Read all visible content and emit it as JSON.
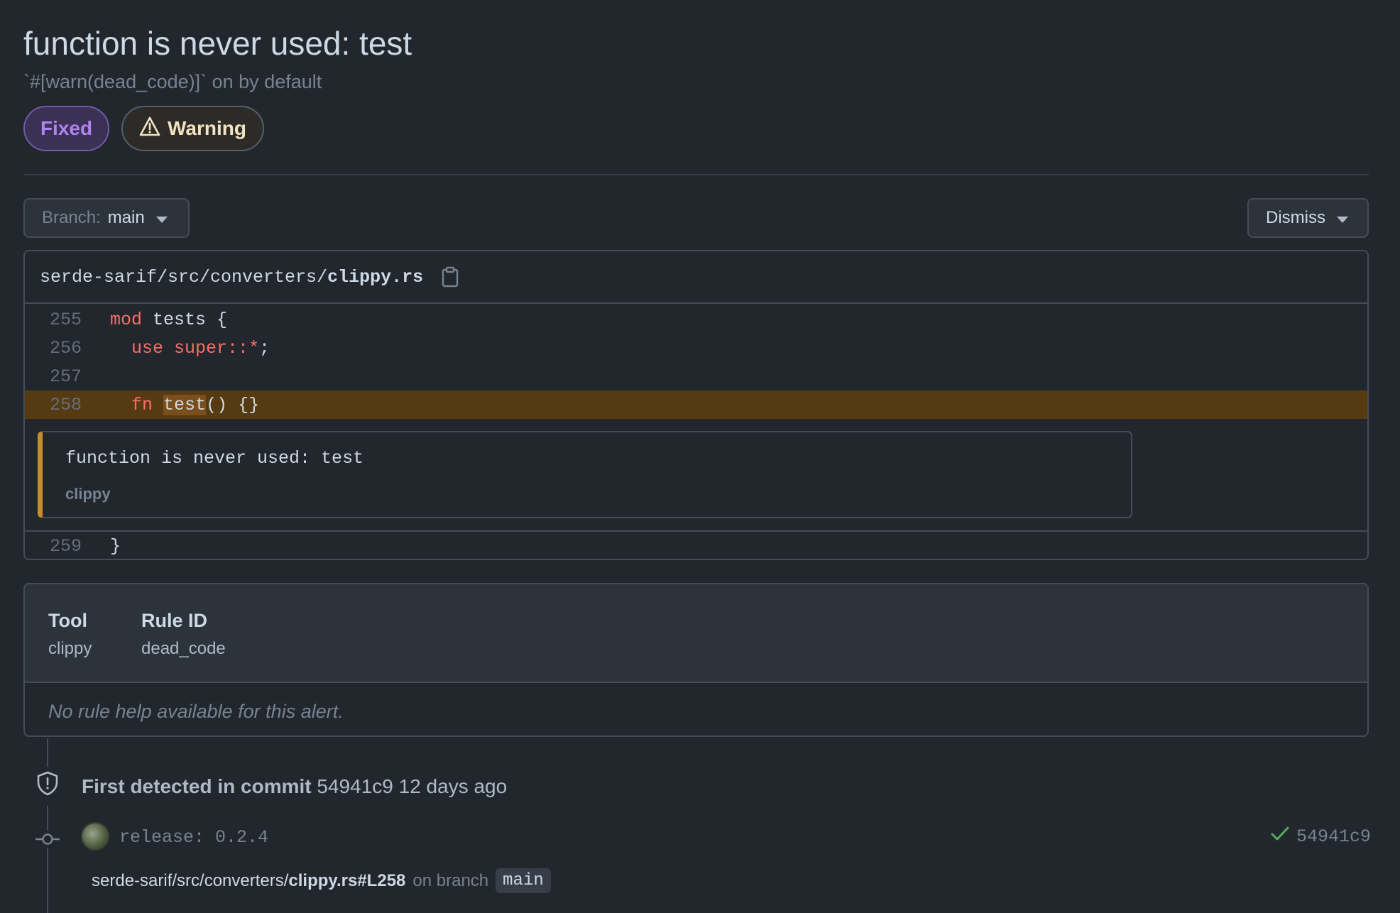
{
  "alert": {
    "title": "function is never used: test",
    "subtitle": "`#[warn(dead_code)]` on by default",
    "status_badge": "Fixed",
    "severity_badge": "Warning"
  },
  "controls": {
    "branch_label": "Branch:",
    "branch_value": "main",
    "dismiss_label": "Dismiss"
  },
  "code": {
    "path_prefix": "serde-sarif/src/converters/",
    "file_name": "clippy.rs",
    "lines": [
      {
        "num": "255",
        "tokens": [
          {
            "t": "mod",
            "kw": true
          },
          {
            "t": " tests {"
          }
        ]
      },
      {
        "num": "256",
        "tokens": [
          {
            "t": "  "
          },
          {
            "t": "use super::*",
            "kw": true
          },
          {
            "t": ";"
          }
        ]
      },
      {
        "num": "257",
        "tokens": []
      },
      {
        "num": "258",
        "tokens": [
          {
            "t": "  "
          },
          {
            "t": "fn",
            "kw": true
          },
          {
            "t": " "
          },
          {
            "t": "test",
            "hl": true
          },
          {
            "t": "() {}"
          }
        ]
      },
      {
        "num": "259",
        "tokens": [
          {
            "t": "}"
          }
        ]
      }
    ],
    "annotation": {
      "message": "function is never used: test",
      "tool": "clippy"
    }
  },
  "info": {
    "tool_label": "Tool",
    "tool_value": "clippy",
    "rule_label": "Rule ID",
    "rule_value": "dead_code",
    "help_text": "No rule help available for this alert."
  },
  "timeline": {
    "detected_strong": "First detected in commit",
    "detected_rest": "54941c9 12 days ago",
    "commit_message": "release: 0.2.4",
    "commit_sha": "54941c9",
    "path_prefix": "serde-sarif/src/converters/",
    "path_file": "clippy.rs#L258",
    "on_branch": "on branch",
    "branch": "main"
  },
  "colors": {
    "background": "#22272e",
    "keyword": "#f47067",
    "highlight_line": "#553a12",
    "fixed_badge": "#b083f0",
    "annotation_bar": "#c69026",
    "check": "#57ab5a"
  }
}
